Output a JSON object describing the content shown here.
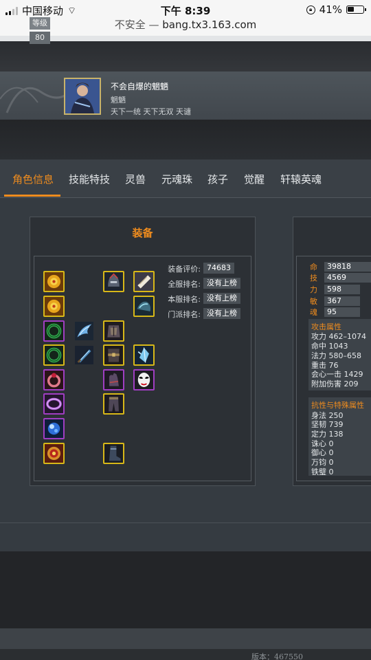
{
  "status": {
    "carrier": "中国移动",
    "time": "下午 8:39",
    "battery": "41%"
  },
  "url": {
    "security": "不安全 —",
    "domain": "bang.tx3.163.com"
  },
  "profile": {
    "level_label": "等级",
    "level": "80",
    "name": "不会自爆的魍魉",
    "class": "魍魉",
    "server": "天下一统 天下无双 天谴"
  },
  "tabs": [
    {
      "label": "角色信息",
      "active": true
    },
    {
      "label": "技能特技",
      "active": false
    },
    {
      "label": "灵兽",
      "active": false
    },
    {
      "label": "元魂珠",
      "active": false
    },
    {
      "label": "孩子",
      "active": false
    },
    {
      "label": "觉醒",
      "active": false
    },
    {
      "label": "轩辕英魂",
      "active": false
    }
  ],
  "equipment": {
    "title": "装备",
    "stats": [
      {
        "label": "装备评价:",
        "value": "74683"
      },
      {
        "label": "全服排名:",
        "value": "没有上榜"
      },
      {
        "label": "本服排名:",
        "value": "没有上榜"
      },
      {
        "label": "门派排名:",
        "value": "没有上榜"
      }
    ],
    "slots": [
      {
        "icon": "gold-amulet-icon",
        "rarity": "gold"
      },
      {
        "icon": "dark-helmet-icon",
        "rarity": "gold"
      },
      {
        "icon": "scroll-icon",
        "rarity": "gold"
      },
      {
        "icon": "gold-amulet-icon",
        "rarity": "gold"
      },
      {
        "icon": "shoulder-armor-icon",
        "rarity": "gold"
      },
      {
        "icon": "jade-ring-icon",
        "rarity": "purple"
      },
      {
        "icon": "ice-wing-icon",
        "rarity": "none"
      },
      {
        "icon": "chest-armor-icon",
        "rarity": "gold"
      },
      {
        "icon": "jade-ring-icon",
        "rarity": "gold"
      },
      {
        "icon": "blade-weapon-icon",
        "rarity": "none"
      },
      {
        "icon": "belt-armor-icon",
        "rarity": "gold"
      },
      {
        "icon": "crystal-shard-icon",
        "rarity": "gold"
      },
      {
        "icon": "red-ring-icon",
        "rarity": "purple"
      },
      {
        "icon": "gloves-icon",
        "rarity": "purple"
      },
      {
        "icon": "opera-mask-icon",
        "rarity": "purple"
      },
      {
        "icon": "violet-band-icon",
        "rarity": "purple"
      },
      {
        "icon": "leggings-icon",
        "rarity": "gold"
      },
      {
        "icon": "blue-gem-icon",
        "rarity": "purple"
      },
      {
        "icon": "red-gold-talisman-icon",
        "rarity": "gold"
      },
      {
        "icon": "boots-icon",
        "rarity": "gold"
      }
    ]
  },
  "attributes": {
    "basic": [
      {
        "k": "命",
        "v": "39818"
      },
      {
        "k": "技",
        "v": "4569"
      },
      {
        "k": "力",
        "v": "598"
      },
      {
        "k": "敏",
        "v": "367"
      },
      {
        "k": "魂",
        "v": "95"
      }
    ],
    "attack_title": "攻击属性",
    "attack": [
      "攻力 462–1074",
      "命中 1043",
      "法力 580–658",
      "重击 76",
      "会心一击 1429",
      "附加伤害 209"
    ],
    "resist_title": "抗性与特殊属性",
    "resist": [
      "身法 250",
      "坚韧 739",
      "定力 138",
      "诛心 0",
      "御心 0",
      "万钧 0",
      "铁璧 0"
    ]
  },
  "version": "版本：467550",
  "colors": {
    "accent": "#ef8c1e",
    "gold_border": "#d8b818",
    "purple_border": "#a03ec2"
  }
}
